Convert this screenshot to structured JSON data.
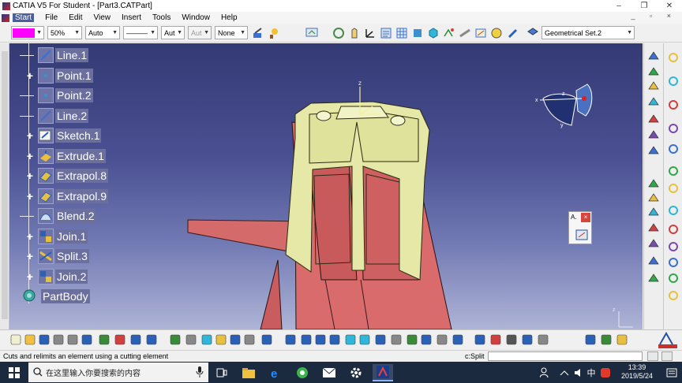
{
  "window": {
    "title": "CATIA V5 For Student - [Part3.CATPart]",
    "controls": [
      "–",
      "❐",
      "✕"
    ]
  },
  "menubar": {
    "items": [
      "Start",
      "File",
      "Edit",
      "View",
      "Insert",
      "Tools",
      "Window",
      "Help"
    ],
    "mdi_controls": "_ ▫ ×"
  },
  "toolbar1": {
    "color_value": "#ff00ff",
    "transparency": "50%",
    "linetype": "Auto",
    "linestyle": "———",
    "lineweight": "Aut",
    "point_symbol": "Aut",
    "layer": "None",
    "current_geometry": "Geometrical Set.2"
  },
  "tree": {
    "items": [
      {
        "label": "Line.1",
        "expandable": false,
        "icon": "line-icon"
      },
      {
        "label": "Point.1",
        "expandable": true,
        "icon": "point-icon"
      },
      {
        "label": "Point.2",
        "expandable": false,
        "icon": "point-icon"
      },
      {
        "label": "Line.2",
        "expandable": false,
        "icon": "line-icon"
      },
      {
        "label": "Sketch.1",
        "expandable": true,
        "icon": "sketch-icon"
      },
      {
        "label": "Extrude.1",
        "expandable": true,
        "icon": "extrude-icon"
      },
      {
        "label": "Extrapol.8",
        "expandable": true,
        "icon": "extrapolate-icon"
      },
      {
        "label": "Extrapol.9",
        "expandable": true,
        "icon": "extrapolate-icon"
      },
      {
        "label": "Blend.2",
        "expandable": false,
        "icon": "blend-icon"
      },
      {
        "label": "Join.1",
        "expandable": true,
        "icon": "join-icon"
      },
      {
        "label": "Split.3",
        "expandable": true,
        "icon": "split-icon"
      },
      {
        "label": "Join.2",
        "expandable": true,
        "icon": "join-icon"
      }
    ],
    "root": {
      "label": "PartBody",
      "icon": "partbody-icon"
    }
  },
  "viewport": {
    "axis_label": "z",
    "compass_labels": [
      "x",
      "y",
      "z"
    ],
    "popup_title": "A.",
    "popup_close": "×"
  },
  "statusbar": {
    "message": "Cuts and relimits an element using a cutting element",
    "command_label": "c:Split",
    "command_value": ""
  },
  "taskbar": {
    "search_placeholder": "在这里输入你要搜索的内容",
    "ime_lang": "中",
    "time": "13:39",
    "date": "2019/5/24"
  },
  "colors": {
    "viewport_top": "#343a74",
    "viewport_bottom": "#aeb4d6",
    "part_red": "#d9676a",
    "part_yellow": "#e4e7a4",
    "tree_label_bg": "#6b6f9e"
  }
}
